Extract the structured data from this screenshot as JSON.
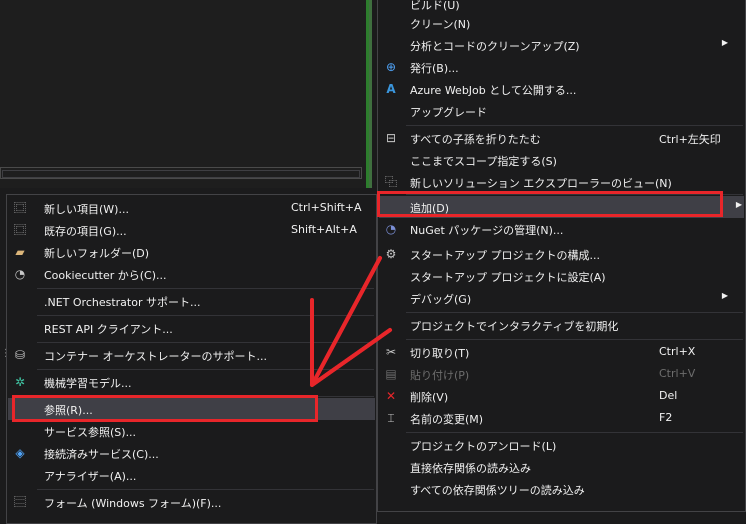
{
  "right_menu": {
    "items": [
      {
        "icon": "build-icon",
        "label": "ビルド(U)"
      },
      {
        "icon": "",
        "label": "クリーン(N)"
      },
      {
        "icon": "",
        "label": "分析とコードのクリーンアップ(Z)",
        "submenu": true
      },
      {
        "icon": "globe-icon",
        "label": "発行(B)..."
      },
      {
        "icon": "azure-icon",
        "label": "Azure WebJob として公開する..."
      },
      {
        "icon": "",
        "label": "アップグレード"
      },
      {
        "icon": "collapse-icon",
        "label": "すべての子孫を折りたたむ",
        "shortcut": "Ctrl+左矢印"
      },
      {
        "icon": "",
        "label": "ここまでスコープ指定する(S)"
      },
      {
        "icon": "new-explorer-view-icon",
        "label": "新しいソリューション エクスプローラーのビュー(N)"
      },
      {
        "icon": "",
        "label": "追加(D)",
        "submenu": true
      },
      {
        "icon": "nuget-icon",
        "label": "NuGet パッケージの管理(N)..."
      },
      {
        "icon": "gear-icon",
        "label": "スタートアップ プロジェクトの構成..."
      },
      {
        "icon": "",
        "label": "スタートアップ プロジェクトに設定(A)"
      },
      {
        "icon": "",
        "label": "デバッグ(G)",
        "submenu": true
      },
      {
        "icon": "",
        "label": "プロジェクトでインタラクティブを初期化"
      },
      {
        "icon": "cut-icon",
        "label": "切り取り(T)",
        "shortcut": "Ctrl+X"
      },
      {
        "icon": "paste-icon",
        "label": "貼り付け(P)",
        "shortcut": "Ctrl+V",
        "disabled": true
      },
      {
        "icon": "delete-icon",
        "label": "削除(V)",
        "shortcut": "Del"
      },
      {
        "icon": "rename-icon",
        "label": "名前の変更(M)",
        "shortcut": "F2"
      },
      {
        "icon": "",
        "label": "プロジェクトのアンロード(L)"
      },
      {
        "icon": "",
        "label": "直接依存関係の読み込み"
      },
      {
        "icon": "",
        "label": "すべての依存関係ツリーの読み込み"
      }
    ]
  },
  "left_menu": {
    "items": [
      {
        "icon": "new-item-icon",
        "label": "新しい項目(W)...",
        "shortcut": "Ctrl+Shift+A"
      },
      {
        "icon": "existing-item-icon",
        "label": "既存の項目(G)...",
        "shortcut": "Shift+Alt+A"
      },
      {
        "icon": "new-folder-icon",
        "label": "新しいフォルダー(D)"
      },
      {
        "icon": "cookiecutter-icon",
        "label": "Cookiecutter から(C)..."
      },
      {
        "icon": "",
        "label": ".NET Orchestrator サポート..."
      },
      {
        "icon": "",
        "label": "REST API クライアント..."
      },
      {
        "icon": "container-icon",
        "label": "コンテナー オーケストレーターのサポート..."
      },
      {
        "icon": "ml-model-icon",
        "label": "機械学習モデル..."
      },
      {
        "icon": "",
        "label": "参照(R)..."
      },
      {
        "icon": "",
        "label": "サービス参照(S)..."
      },
      {
        "icon": "connected-service-icon",
        "label": "接続済みサービス(C)..."
      },
      {
        "icon": "",
        "label": "アナライザー(A)..."
      },
      {
        "icon": "form-icon",
        "label": "フォーム (Windows フォーム)(F)..."
      }
    ]
  },
  "colors": {
    "accent_red": "#e8262a",
    "menu_bg": "#1b1b1c",
    "highlight": "#3f3f46"
  }
}
